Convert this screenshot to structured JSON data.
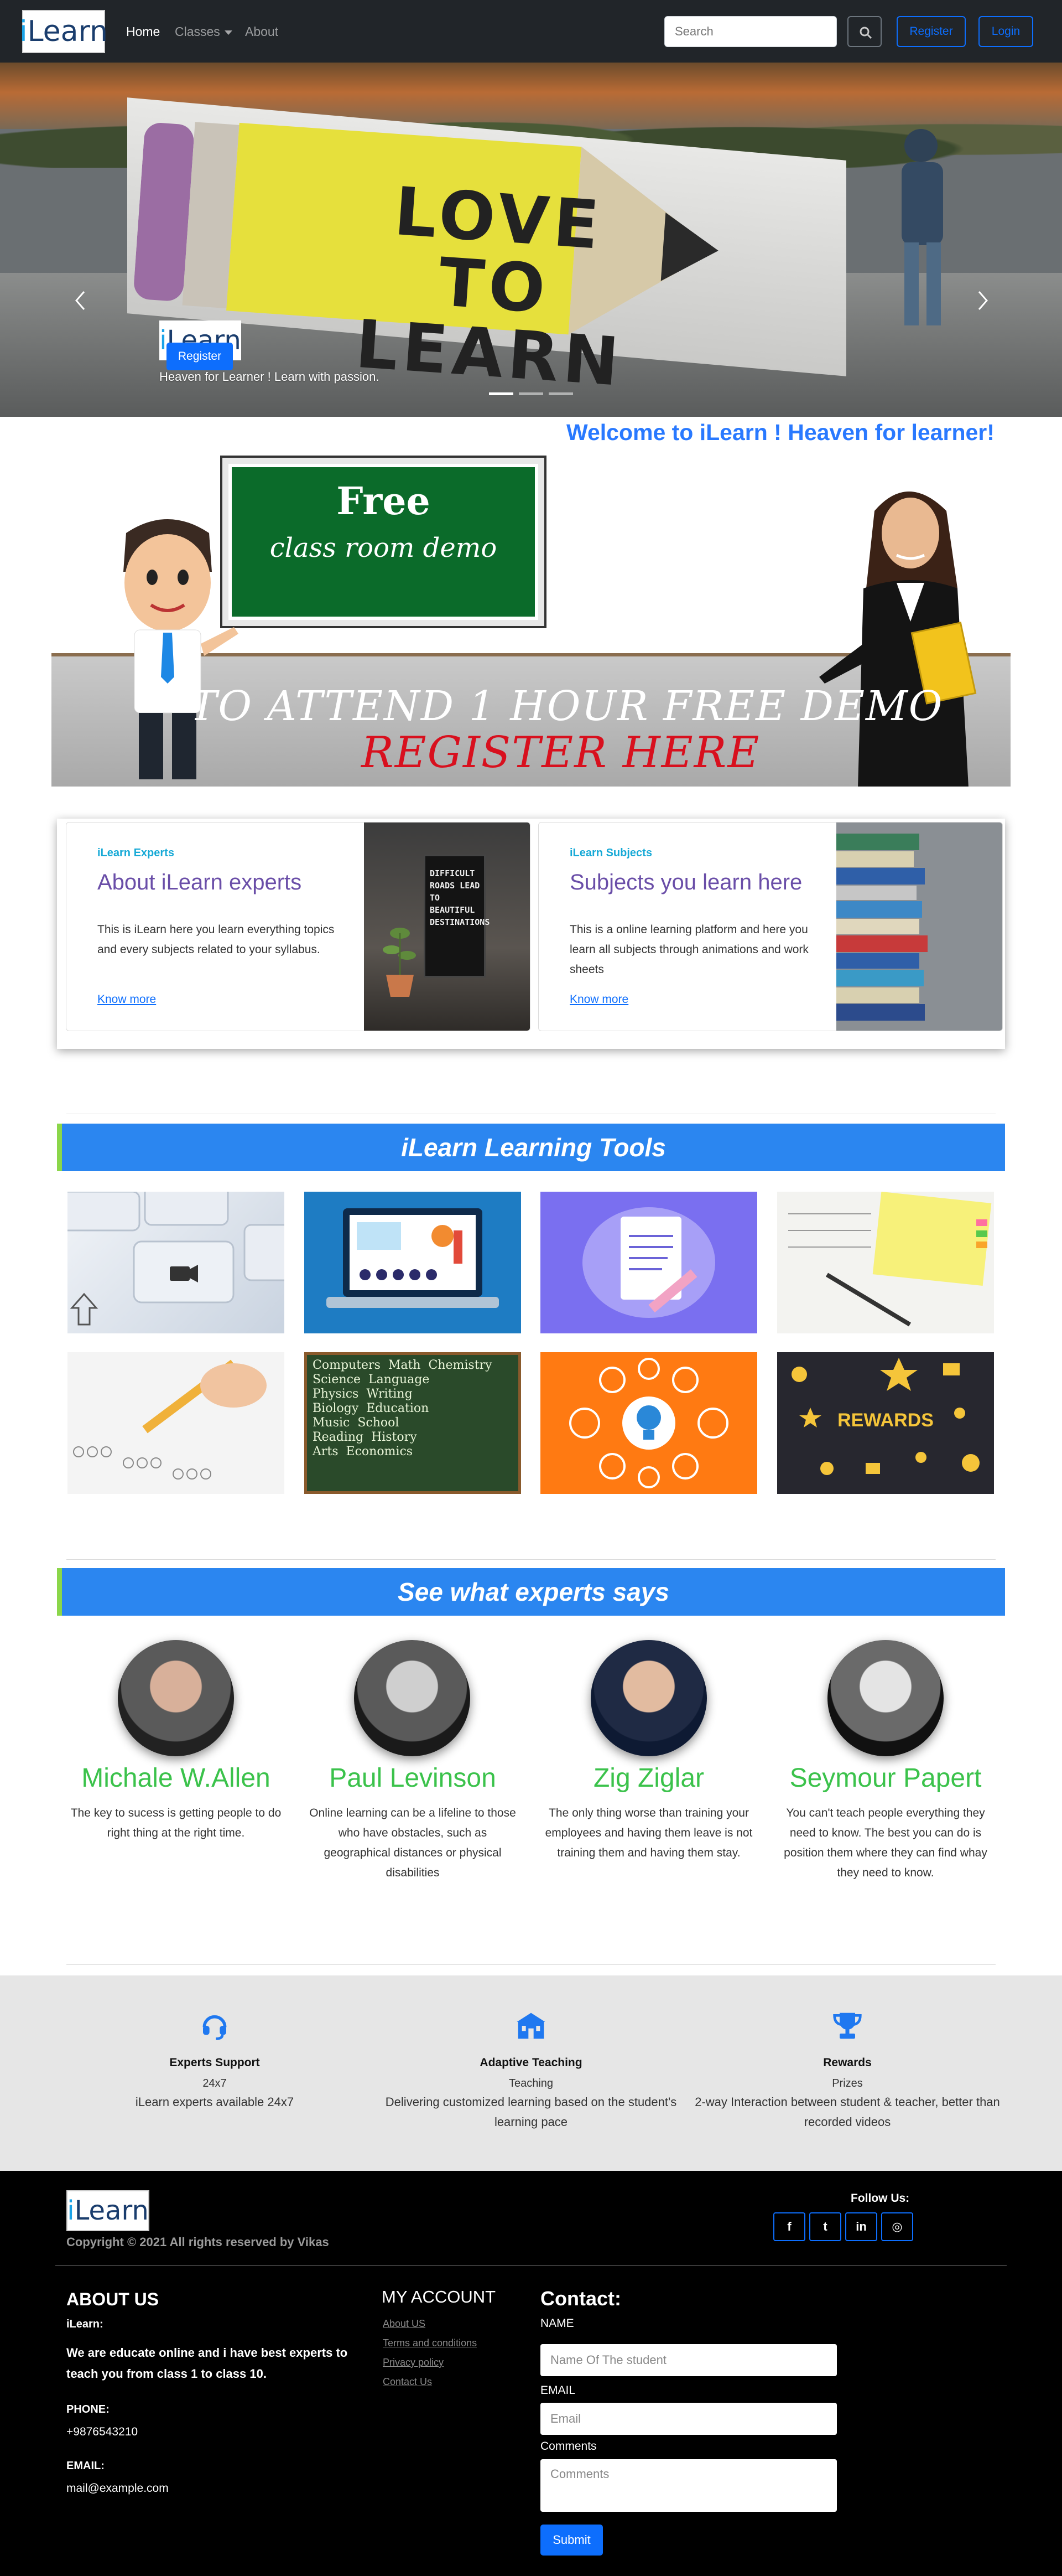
{
  "navbar": {
    "brand": "iLearn",
    "links": [
      {
        "label": "Home"
      },
      {
        "label": "Classes"
      },
      {
        "label": "About"
      }
    ],
    "search_placeholder": "Search",
    "register_label": "Register",
    "login_label": "Login"
  },
  "hero": {
    "sign_text": "LOVE TO LEARN",
    "logo": "iLearn",
    "tagline": "Heaven for Learner ! Learn with passion.",
    "register_label": "Register",
    "slides": 3,
    "active_slide": 1
  },
  "welcome": "Welcome to iLearn ! Heaven for learner!",
  "demo_banner": {
    "board_title": "Free",
    "board_subtitle": "class room demo",
    "line1": "TO ATTEND 1 HOUR FREE DEMO",
    "line2": "REGISTER HERE"
  },
  "cards": [
    {
      "eyebrow": "iLearn Experts",
      "title": "About iLearn experts",
      "text": "This is iLearn here you learn everything topics and every subjects related to your syllabus.",
      "link": "Know more",
      "sign": "DIFFICULT ROADS LEAD TO BEAUTIFUL DESTINATIONS"
    },
    {
      "eyebrow": "iLearn Subjects",
      "title": "Subjects you learn here",
      "text": "This is a online learning platform and here you learn all subjects through animations and work sheets",
      "link": "Know more"
    }
  ],
  "tools": {
    "title": "iLearn Learning Tools",
    "items": [
      {
        "icon": "keyboard-video-key"
      },
      {
        "icon": "laptop-online-class"
      },
      {
        "icon": "notepad-pencil"
      },
      {
        "icon": "notebook-pen"
      },
      {
        "icon": "answer-sheet-pencil"
      },
      {
        "icon": "chalkboard-subjects",
        "board_words": [
          "Computers",
          "Math",
          "Chemistry",
          "Science",
          "Language",
          "Physics",
          "Writing",
          "Biology",
          "Education",
          "Music",
          "School",
          "Reading",
          "History",
          "Arts",
          "Economics"
        ]
      },
      {
        "icon": "lightbulb-ideas"
      },
      {
        "icon": "rewards-trophies",
        "label": "REWARDS"
      }
    ]
  },
  "experts": {
    "title": "See what experts says",
    "people": [
      {
        "name": "Michale W.Allen",
        "quote": "The key to sucess is getting people to do right thing at the right time."
      },
      {
        "name": "Paul Levinson",
        "quote": "Online learning can be a lifeline to those who have obstacles, such as geographical distances or physical disabilities"
      },
      {
        "name": "Zig Ziglar",
        "quote": "The only thing worse than training your employees and having them leave is not training them and having them stay."
      },
      {
        "name": "Seymour Papert",
        "quote": "You can't teach people everything they need to know. The best you can do is position them where they can find whay they need to know."
      }
    ]
  },
  "features": [
    {
      "icon": "headset-icon",
      "title": "Experts Support",
      "sub": "24x7",
      "desc": "iLearn experts available 24x7"
    },
    {
      "icon": "school-icon",
      "title": "Adaptive Teaching",
      "sub": "Teaching",
      "desc": "Delivering customized learning based on the student's learning pace"
    },
    {
      "icon": "trophy-icon",
      "title": "Rewards",
      "sub": "Prizes",
      "desc": "2-way Interaction between student & teacher, better than recorded videos"
    }
  ],
  "footer": {
    "brand": "iLearn",
    "copyright": "Copyright © 2021 All rights reserved by Vikas",
    "follow_us": "Follow Us:",
    "social": [
      {
        "icon": "facebook-icon",
        "glyph": "f"
      },
      {
        "icon": "twitter-icon",
        "glyph": "t"
      },
      {
        "icon": "linkedin-icon",
        "glyph": "in"
      },
      {
        "icon": "instagram-icon",
        "glyph": "◎"
      }
    ],
    "about": {
      "title": "ABOUT US",
      "name": "iLearn:",
      "text": "We are educate online and i have best experts to teach you from class 1 to class 10.",
      "phone_label": "PHONE:",
      "phone": "+9876543210",
      "email_label": "EMAIL:",
      "email": "mail@example.com"
    },
    "account": {
      "title": "MY ACCOUNT",
      "links": [
        "About US",
        "Terms and conditions",
        "Privacy policy",
        "Contact Us"
      ]
    },
    "contact": {
      "title": "Contact:",
      "name_label": "NAME",
      "name_value": "Name Of The student",
      "email_label": "EMAIL",
      "email_placeholder": "Email",
      "comments_label": "Comments",
      "comments_placeholder": "Comments",
      "submit_label": "Submit"
    }
  },
  "colors": {
    "navbar": "#212529",
    "primary": "#0d6efd",
    "welcome": "#2979ff",
    "section_head": "#2b86f0",
    "section_accent": "#8bd64a",
    "expert_name": "#3bc24b",
    "card_title": "#6a4ea8",
    "card_eyebrow": "#16a9d6",
    "features_bg": "#e6e6e6",
    "footer_bg": "#000000"
  }
}
